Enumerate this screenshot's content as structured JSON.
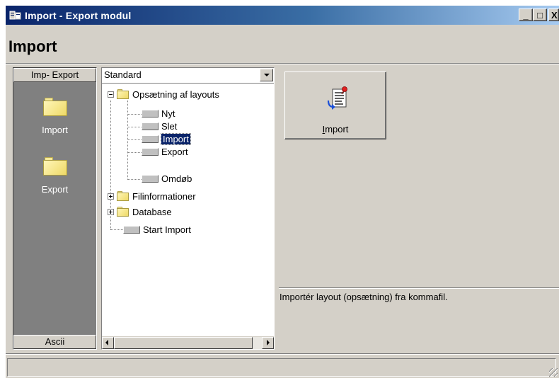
{
  "window": {
    "title": "Import - Export modul",
    "minimize_label": "_",
    "maximize_label": "□",
    "close_label": "X"
  },
  "header": {
    "title": "Import"
  },
  "leftbar": {
    "top_button": "Imp- Export",
    "items": [
      {
        "label": "Import",
        "icon": "folder-icon"
      },
      {
        "label": "Export",
        "icon": "folder-icon"
      }
    ],
    "bottom_button": "Ascii"
  },
  "combo": {
    "value": "Standard"
  },
  "tree": {
    "nodes": [
      {
        "label": "Opsætning af layouts",
        "type": "folder",
        "expanded": true
      },
      {
        "label": "Nyt",
        "type": "leaf"
      },
      {
        "label": "Slet",
        "type": "leaf"
      },
      {
        "label": "Import",
        "type": "leaf",
        "selected": true
      },
      {
        "label": "Export",
        "type": "leaf"
      },
      {
        "label": "Omdøb",
        "type": "leaf"
      },
      {
        "label": "Filinformationer",
        "type": "folder",
        "expanded": false
      },
      {
        "label": "Database",
        "type": "folder",
        "expanded": false
      },
      {
        "label": "Start Import",
        "type": "leaf"
      }
    ]
  },
  "action": {
    "label_prefix": "I",
    "label_rest": "mport"
  },
  "description": "Importér layout (opsætning) fra kommafil.",
  "colors": {
    "titlebar_start": "#0a246a",
    "titlebar_end": "#a6caf0",
    "selection": "#0a246a",
    "face": "#d4d0c8",
    "outlook_bar": "#808080"
  }
}
